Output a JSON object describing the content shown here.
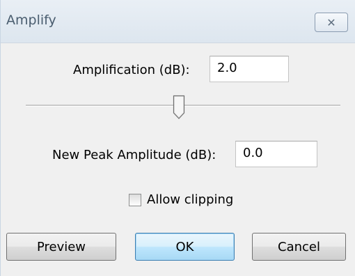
{
  "window": {
    "title": "Amplify",
    "close_glyph": "✕"
  },
  "amplification": {
    "label": "Amplification (dB):",
    "value": "2.0"
  },
  "slider": {
    "level": 0.49
  },
  "peak": {
    "label": "New Peak Amplitude (dB):",
    "value": "0.0"
  },
  "clipping": {
    "label": "Allow clipping",
    "checked": false
  },
  "buttons": {
    "preview": "Preview",
    "ok": "OK",
    "cancel": "Cancel"
  },
  "icons": {
    "close": "close-icon",
    "slider_thumb": "slider-thumb-icon",
    "checkbox": "checkbox-icon"
  },
  "colors": {
    "titlebar_text": "#4a5d6f",
    "default_button_border": "#3c7fb1"
  }
}
